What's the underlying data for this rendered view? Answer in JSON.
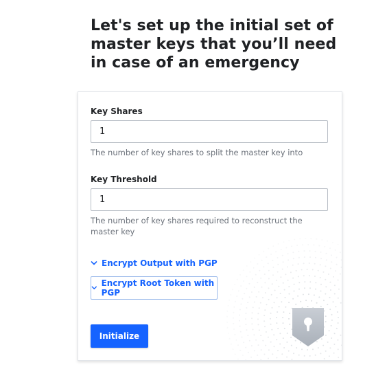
{
  "heading": "Let's set up the initial set of master keys that you’ll need in case of an emergency",
  "key_shares": {
    "label": "Key Shares",
    "value": "1",
    "help": "The number of key shares to split the master key into"
  },
  "key_threshold": {
    "label": "Key Threshold",
    "value": "1",
    "help": "The number of key shares required to reconstruct the master key"
  },
  "toggles": {
    "encrypt_output": "Encrypt Output with PGP",
    "encrypt_root": "Encrypt Root Token with PGP"
  },
  "initialize_button": "Initialize",
  "colors": {
    "accent": "#1563ff",
    "text": "#1f2124",
    "muted": "#6a7079",
    "border": "#b6bcc4"
  },
  "icons": {
    "chevron": "chevron-down-icon",
    "shield": "shield-lock-icon"
  }
}
